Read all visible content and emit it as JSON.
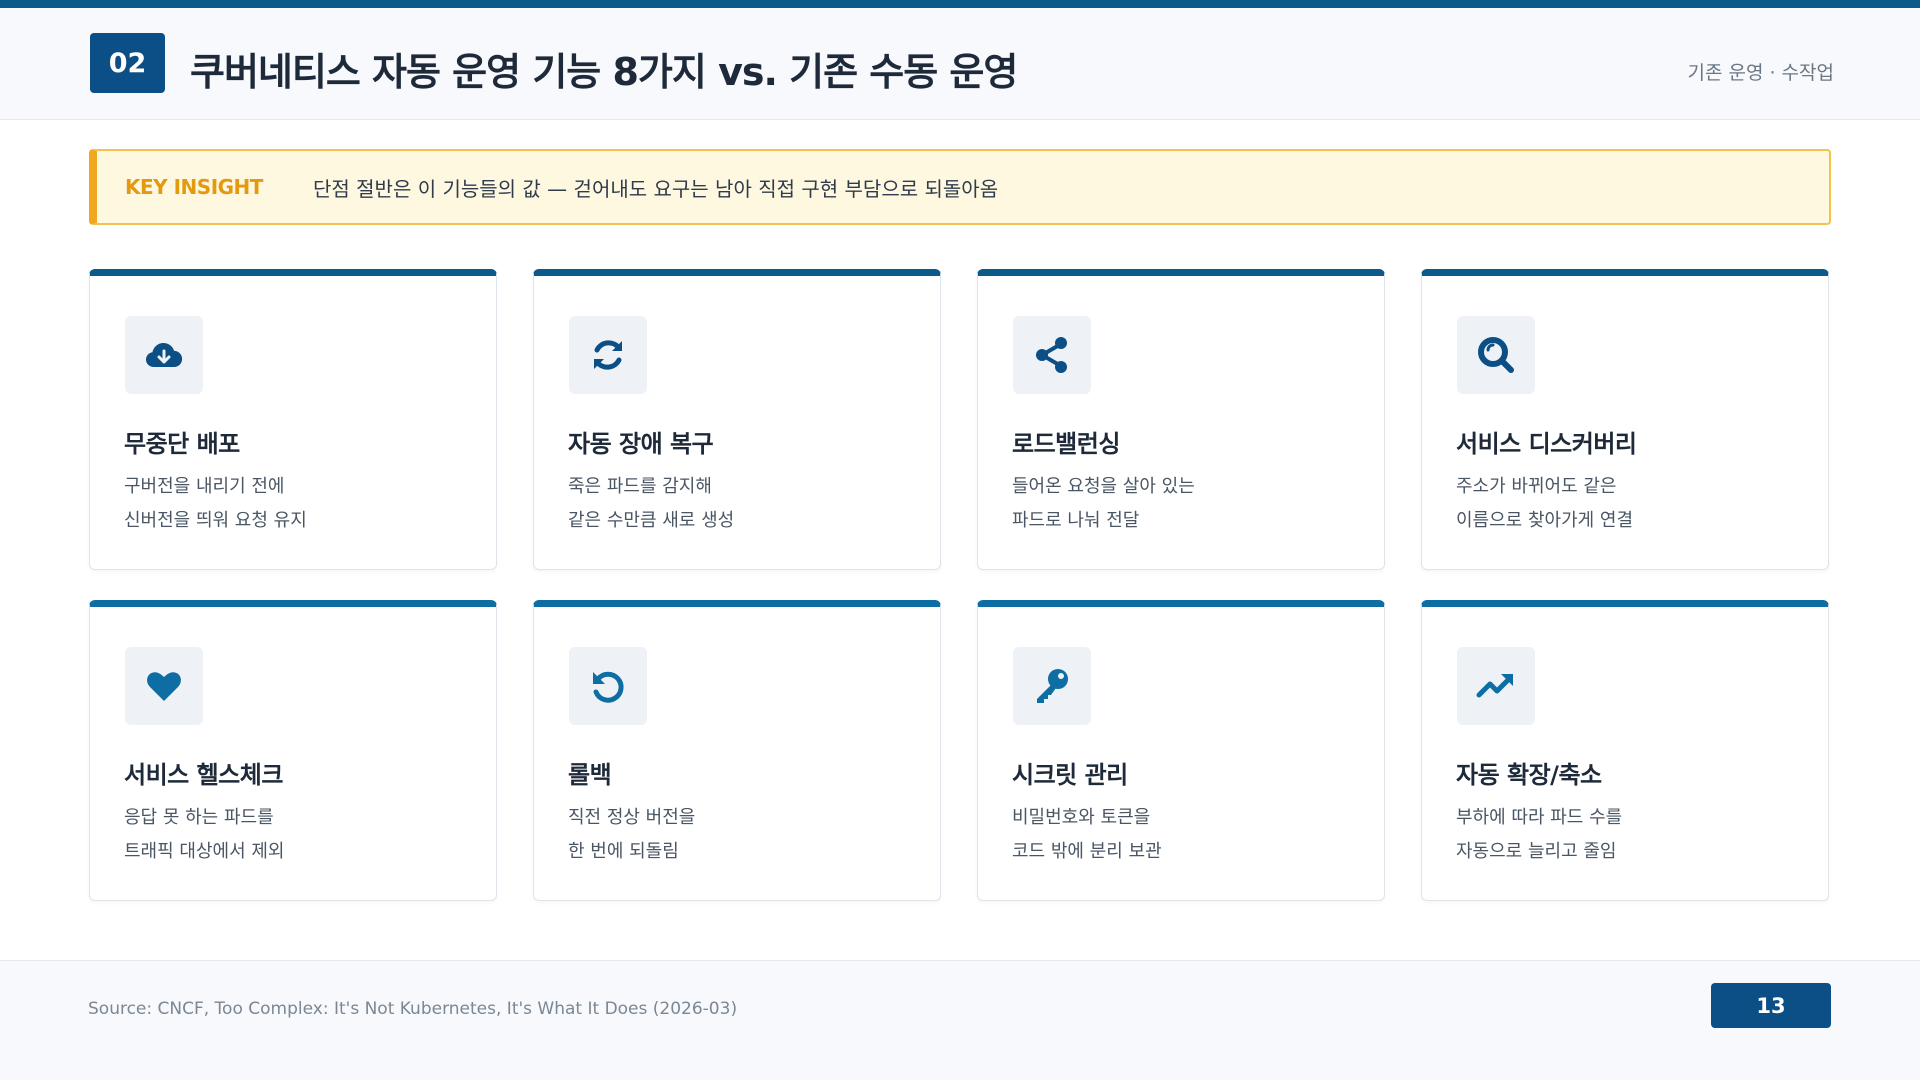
{
  "header": {
    "section_number": "02",
    "title": "쿠버네티스 자동 운영 기능 8가지 vs. 기존 수동 운영",
    "meta": "기존 운영 · 수작업"
  },
  "insight": {
    "label": "KEY INSIGHT",
    "text": "단점 절반은 이 기능들의 값 — 걷어내도 요구는 남아 직접 구현 부담으로 되돌아옴"
  },
  "cards": [
    {
      "icon": "cloud-download-icon",
      "title": "무중단 배포",
      "line1": "구버전을 내리기 전에",
      "line2": "신버전을 띄워 요청 유지"
    },
    {
      "icon": "sync-icon",
      "title": "자동 장애 복구",
      "line1": "죽은 파드를 감지해",
      "line2": "같은 수만큼 새로 생성"
    },
    {
      "icon": "share-icon",
      "title": "로드밸런싱",
      "line1": "들어온 요청을 살아 있는",
      "line2": "파드로 나눠 전달"
    },
    {
      "icon": "search-icon",
      "title": "서비스 디스커버리",
      "line1": "주소가 바뀌어도 같은",
      "line2": "이름으로 찾아가게 연결"
    },
    {
      "icon": "heart-icon",
      "title": "서비스 헬스체크",
      "line1": "응답 못 하는 파드를",
      "line2": "트래픽 대상에서 제외"
    },
    {
      "icon": "undo-icon",
      "title": "롤백",
      "line1": "직전 정상 버전을",
      "line2": "한 번에 되돌림"
    },
    {
      "icon": "key-icon",
      "title": "시크릿 관리",
      "line1": "비밀번호와 토큰을",
      "line2": "코드 밖에 분리 보관"
    },
    {
      "icon": "trending-up-icon",
      "title": "자동 확장/축소",
      "line1": "부하에 따라 파드 수를",
      "line2": "자동으로 늘리고 줄임"
    }
  ],
  "footer": {
    "source": "Source: CNCF, Too Complex: It's Not Kubernetes, It's What It Does (2026-03)",
    "page_number": "13"
  },
  "colors": {
    "primary": "#0b4f86",
    "accent_row2": "#0e6ea3",
    "insight_border": "#f0a81e",
    "insight_bg": "#fff8e1"
  }
}
